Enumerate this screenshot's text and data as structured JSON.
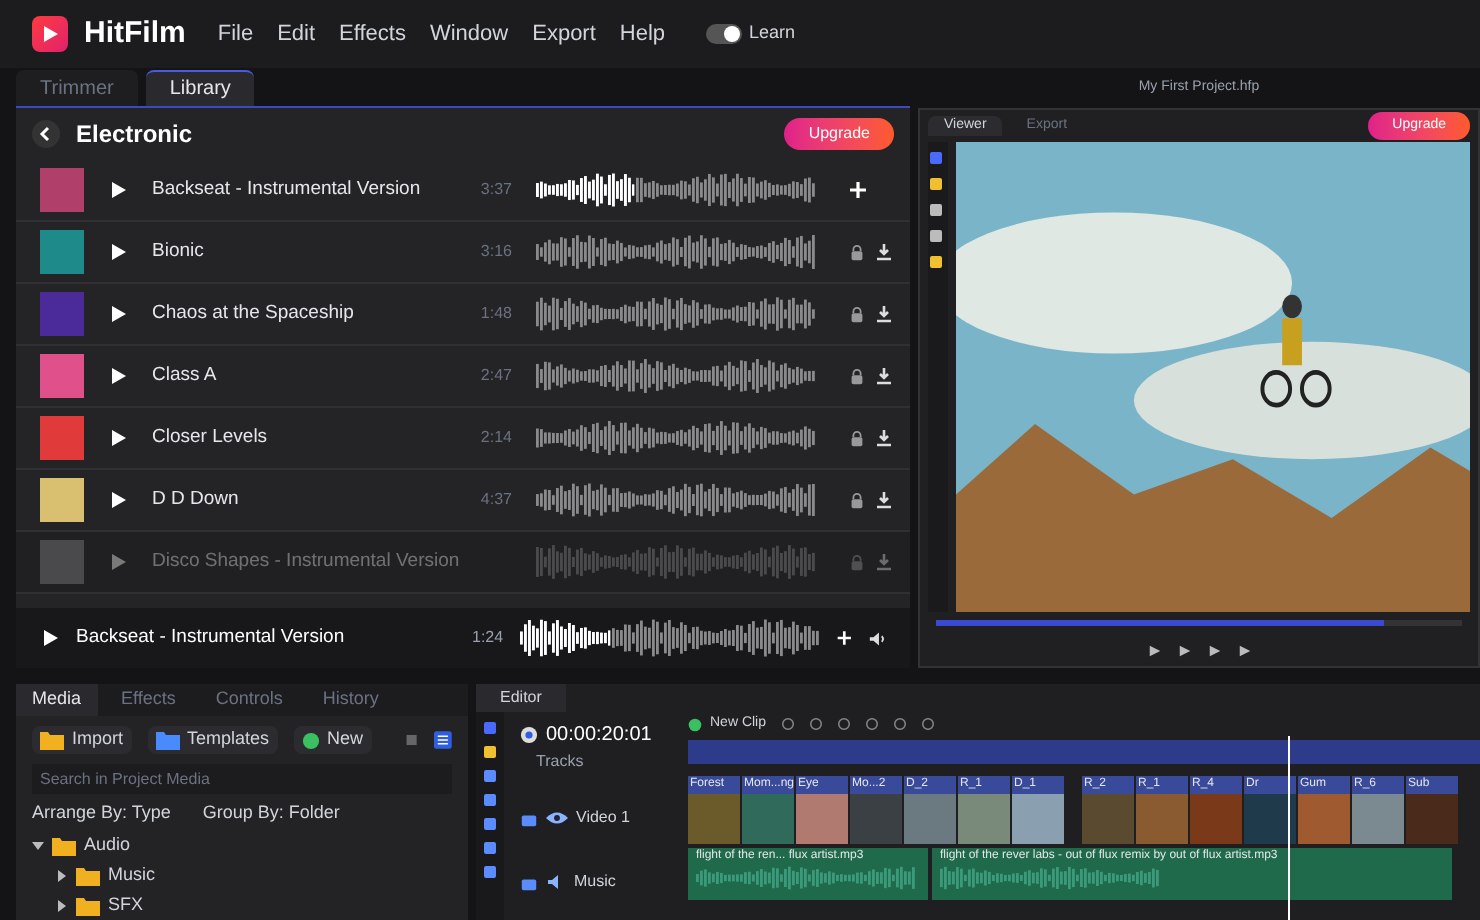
{
  "app": {
    "name": "HitFilm"
  },
  "menu": [
    "File",
    "Edit",
    "Effects",
    "Window",
    "Export",
    "Help"
  ],
  "learn_toggle": {
    "label": "Learn",
    "on": true
  },
  "top_tabs": [
    {
      "label": "Trimmer",
      "selected": false
    },
    {
      "label": "Library",
      "selected": true
    }
  ],
  "library": {
    "category": "Electronic",
    "upgrade_label": "Upgrade",
    "tracks": [
      {
        "title": "Backseat - Instrumental Version",
        "duration": "3:37",
        "color": "#b0406a",
        "kind": "free",
        "level": 0.35,
        "dimmed": false
      },
      {
        "title": "Bionic",
        "duration": "3:16",
        "color": "#1f8a8a",
        "kind": "locked",
        "dimmed": false
      },
      {
        "title": "Chaos at the Spaceship",
        "duration": "1:48",
        "color": "#4b2a9a",
        "kind": "locked",
        "dimmed": false
      },
      {
        "title": "Class A",
        "duration": "2:47",
        "color": "#e0508a",
        "kind": "locked",
        "dimmed": false
      },
      {
        "title": "Closer Levels",
        "duration": "2:14",
        "color": "#e03a3a",
        "kind": "locked",
        "dimmed": false
      },
      {
        "title": "D D Down",
        "duration": "4:37",
        "color": "#d8c070",
        "kind": "locked",
        "dimmed": false
      },
      {
        "title": "Disco Shapes - Instrumental Version",
        "color": "#4a4a4c",
        "kind": "locked",
        "dimmed": true
      }
    ],
    "player": {
      "title": "Backseat - Instrumental Version",
      "duration": "1:24",
      "level": 0.3
    }
  },
  "project": {
    "title": "My First Project.hfp"
  },
  "viewer": {
    "tabs": [
      {
        "label": "Viewer",
        "selected": true
      },
      {
        "label": "Export",
        "selected": false
      }
    ],
    "upgrade_label": "Upgrade",
    "level": 0.85
  },
  "media_panel": {
    "tabs": [
      {
        "label": "Media",
        "selected": true
      },
      {
        "label": "Effects",
        "selected": false
      },
      {
        "label": "Controls",
        "selected": false
      },
      {
        "label": "History",
        "selected": false
      }
    ],
    "buttons": [
      {
        "label": "Import",
        "kind": "import"
      },
      {
        "label": "Templates",
        "kind": "templates"
      },
      {
        "label": "New",
        "kind": "new"
      }
    ],
    "search": {
      "placeholder": "Search in Project Media"
    },
    "arrange": "Arrange By: Type",
    "group": "Group By: Folder",
    "tree": [
      {
        "label": "Audio",
        "expanded": true,
        "children": [
          {
            "label": "Music",
            "expanded": false
          },
          {
            "label": "SFX",
            "expanded": false
          }
        ]
      }
    ]
  },
  "editor": {
    "tab": "Editor",
    "timecode": "00:00:20:01",
    "tracks_label": "Tracks",
    "new_clip": "New Clip",
    "tracks": [
      {
        "label": "Video 1",
        "kind": "video"
      },
      {
        "label": "Music",
        "kind": "audio"
      }
    ],
    "video_clips": [
      {
        "label": "Forest",
        "color": "#6b5a2a"
      },
      {
        "label": "Mom...ng",
        "color": "#2f6a5a"
      },
      {
        "label": "Eye",
        "color": "#b07a70"
      },
      {
        "label": "Mo...2",
        "color": "#3a4044"
      },
      {
        "label": "D_2",
        "color": "#6a7a80"
      },
      {
        "label": "R_1",
        "color": "#7a8a7a"
      },
      {
        "label": "D_1",
        "color": "#8aa0b0"
      },
      {
        "label": "R_2",
        "color": "#5a4a30"
      },
      {
        "label": "R_1",
        "color": "#8a5a30"
      },
      {
        "label": "R_4",
        "color": "#7a3a1a"
      },
      {
        "label": "Dr",
        "color": "#1f3a4a"
      },
      {
        "label": "Gum",
        "color": "#a05a30"
      },
      {
        "label": "R_6",
        "color": "#7a8a90"
      },
      {
        "label": "Sub",
        "color": "#4a2a1a"
      }
    ],
    "audio_clips": [
      "flight of the ren... flux artist.mp3",
      "flight of the rever labs - out of flux remix by out of flux artist.mp3"
    ]
  }
}
